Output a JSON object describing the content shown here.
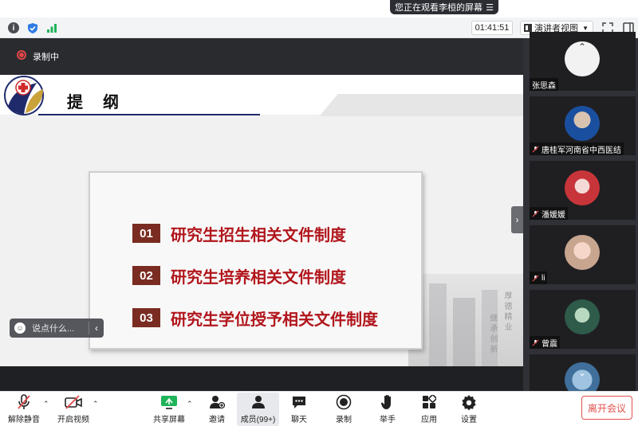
{
  "banner": {
    "text": "您正在观看李桓的屏幕",
    "menu_icon": "list-icon"
  },
  "topbar": {
    "timer": "01:41:51",
    "view_label": "演讲者视图",
    "icons": [
      "info-icon",
      "shield-icon",
      "signal-icon",
      "fullscreen-icon",
      "sidebar-toggle-icon"
    ]
  },
  "recording": {
    "label": "录制中",
    "color": "#e04848"
  },
  "slide": {
    "title": "提 纲",
    "items": [
      {
        "num": "01",
        "text": "研究生招生相关文件制度"
      },
      {
        "num": "02",
        "text": "研究生培养相关文件制度"
      },
      {
        "num": "03",
        "text": "研究生学位授予相关文件制度"
      }
    ],
    "vertical_text_1": "厚德精业",
    "vertical_text_2": "继承创新",
    "accent": "#b1161c",
    "badge_color": "#7a2c22"
  },
  "chat": {
    "placeholder": "说点什么..."
  },
  "participants": [
    {
      "name": "张思森"
    },
    {
      "name": "唐桂军河南省中西医结"
    },
    {
      "name": "潘媛媛"
    },
    {
      "name": "li"
    },
    {
      "name": "曾震"
    }
  ],
  "toolbar": {
    "mute": "解除静音",
    "video": "开启视频",
    "share": "共享屏幕",
    "invite": "邀请",
    "members": "成员(99+)",
    "chat": "聊天",
    "record": "录制",
    "raise_hand": "举手",
    "apps": "应用",
    "settings": "设置",
    "leave": "离开会议"
  }
}
